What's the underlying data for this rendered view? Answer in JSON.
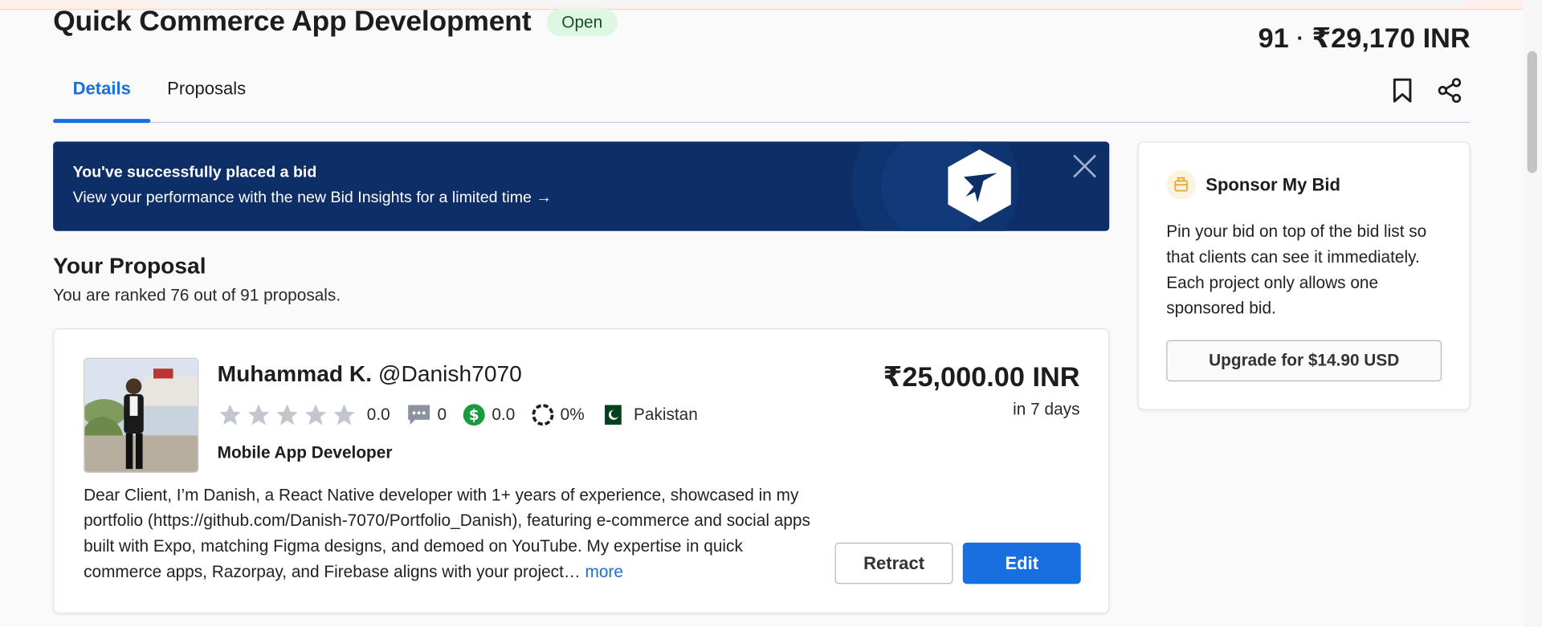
{
  "header": {
    "title": "Quick Commerce App Development",
    "status": "Open",
    "bids_count": "91",
    "separator": "·",
    "avg_bid": "₹29,170 INR"
  },
  "tabs": [
    {
      "label": "Details",
      "active": true
    },
    {
      "label": "Proposals",
      "active": false
    }
  ],
  "banner": {
    "title": "You've successfully placed a bid",
    "text": "View your performance with the new Bid Insights for a limited time →"
  },
  "proposal": {
    "heading": "Your Proposal",
    "rank_text": "You are ranked 76 out of 91 proposals.",
    "name": "Muhammad K.",
    "username": "@Danish7070",
    "rating": "0.0",
    "reviews": "0",
    "earnings_score": "0.0",
    "completion": "0%",
    "country": "Pakistan",
    "role": "Mobile App Developer",
    "amount": "₹25,000.00 INR",
    "delivery": "in 7 days",
    "description": "Dear Client, I’m Danish, a React Native developer with 1+ years of experience, showcased in my portfolio (https://github.com/Danish-7070/Portfolio_Danish), featuring e-commerce and social apps built with Expo, matching Figma designs, and demoed on YouTube. My expertise in quick commerce apps, Razorpay, and Firebase aligns with your project…",
    "more_label": "more",
    "retract_label": "Retract",
    "edit_label": "Edit"
  },
  "sponsor": {
    "title": "Sponsor My Bid",
    "text": "Pin your bid on top of the bid list so that clients can see it immediately. Each project only allows one sponsored bid.",
    "button": "Upgrade for $14.90 USD"
  },
  "icons": {
    "bookmark": "bookmark-icon",
    "share": "share-icon",
    "close": "close-icon",
    "star": "star-icon",
    "reviews": "comment-icon",
    "earnings": "dollar-icon",
    "completion": "progress-ring-icon",
    "flag": "pakistan-flag-icon",
    "sponsor": "sponsor-icon"
  },
  "colors": {
    "accent": "#1a6fe0",
    "banner": "#0d2e66",
    "status_badge": "#def7e2",
    "earnings_green": "#1a9c3c",
    "star_grey": "#c2c6cf"
  }
}
